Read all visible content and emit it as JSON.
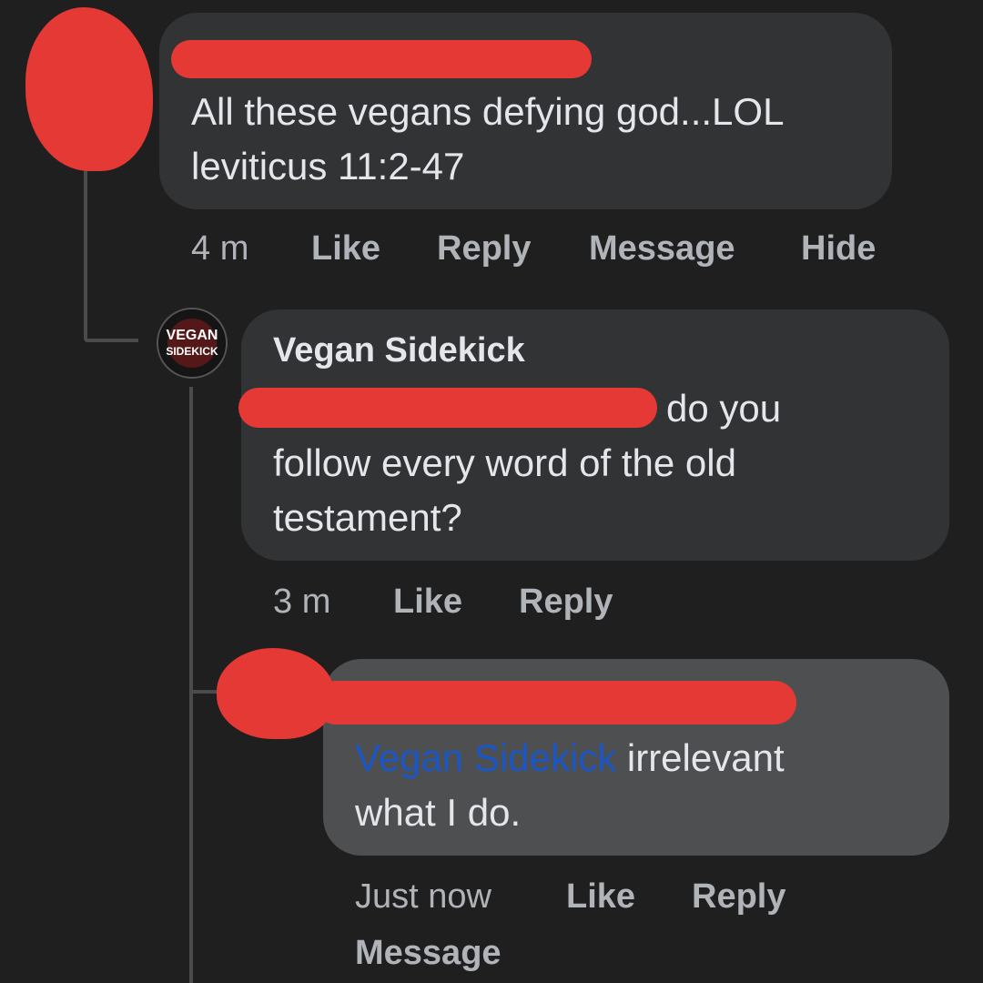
{
  "comments": [
    {
      "author": "",
      "text_lines": [
        "All these vegans defying god...LOL",
        " leviticus 11:2-47"
      ],
      "time": "4 m",
      "actions": [
        "Like",
        "Reply",
        "Message",
        "Hide"
      ]
    },
    {
      "author": "Vegan Sidekick",
      "avatar_text": [
        "VEGAN",
        "SIDEKICK"
      ],
      "text_lines": [
        "do you",
        "follow every word of the old",
        "testament?"
      ],
      "time": "3 m",
      "actions": [
        "Like",
        "Reply"
      ]
    },
    {
      "author": "",
      "mention": "Vegan Sidekick",
      "text_lines": [
        " irrelevant",
        "what I do."
      ],
      "time": "Just now",
      "actions": [
        "Like",
        "Reply",
        "Message"
      ]
    }
  ],
  "colors": {
    "background": "#1f1f20",
    "bubble": "#323335",
    "bubble_highlight": "#4e4f51",
    "redaction": "#e53935",
    "mention": "#1a56c4",
    "action_text": "#b0b3b8"
  }
}
